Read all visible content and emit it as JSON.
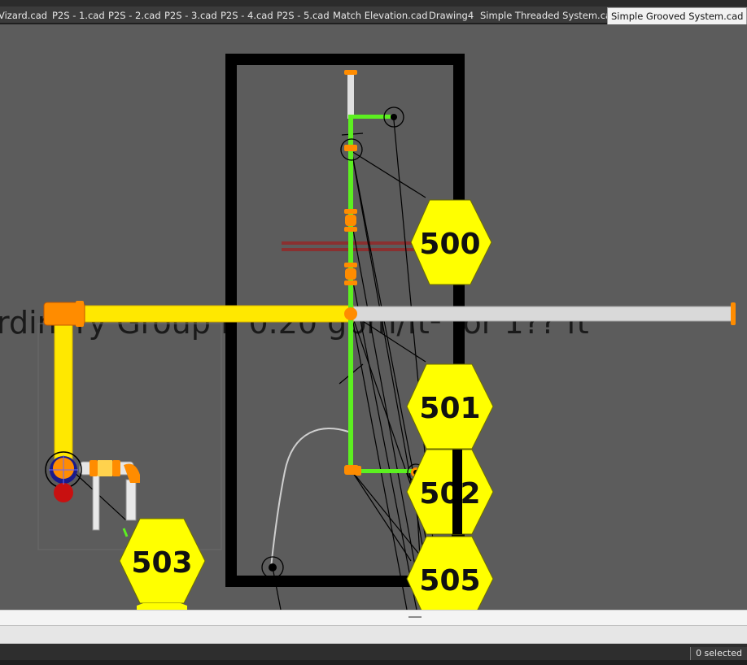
{
  "tabs": [
    {
      "label": "Vizard.cad",
      "active": false
    },
    {
      "label": "P2S - 1.cad",
      "active": false
    },
    {
      "label": "P2S - 2.cad",
      "active": false
    },
    {
      "label": "P2S - 3.cad",
      "active": false
    },
    {
      "label": "P2S - 4.cad",
      "active": false
    },
    {
      "label": "P2S - 5.cad",
      "active": false
    },
    {
      "label": "Match Elevation.cad",
      "active": false
    },
    {
      "label": "Drawing4",
      "active": false
    },
    {
      "label": "Simple Threaded System.cad",
      "active": false
    },
    {
      "label": "Simple Grooved System.cad",
      "active": true
    }
  ],
  "drawing": {
    "background_text": "rdinary Group II 0.20 gpm/ft² for 1?? ft",
    "tags": [
      {
        "label": "500"
      },
      {
        "label": "501"
      },
      {
        "label": "502"
      },
      {
        "label": "505"
      },
      {
        "label": "503"
      }
    ],
    "colors": {
      "canvas": "#5c5c5c",
      "main_pipe": "#ffea00",
      "branch_pipe": "#5cf020",
      "unselected_pipe": "#d9d9d9",
      "fittings": "#ff8c00",
      "tag_fill": "#ffff00"
    }
  },
  "status": {
    "selection": "0 selected"
  }
}
